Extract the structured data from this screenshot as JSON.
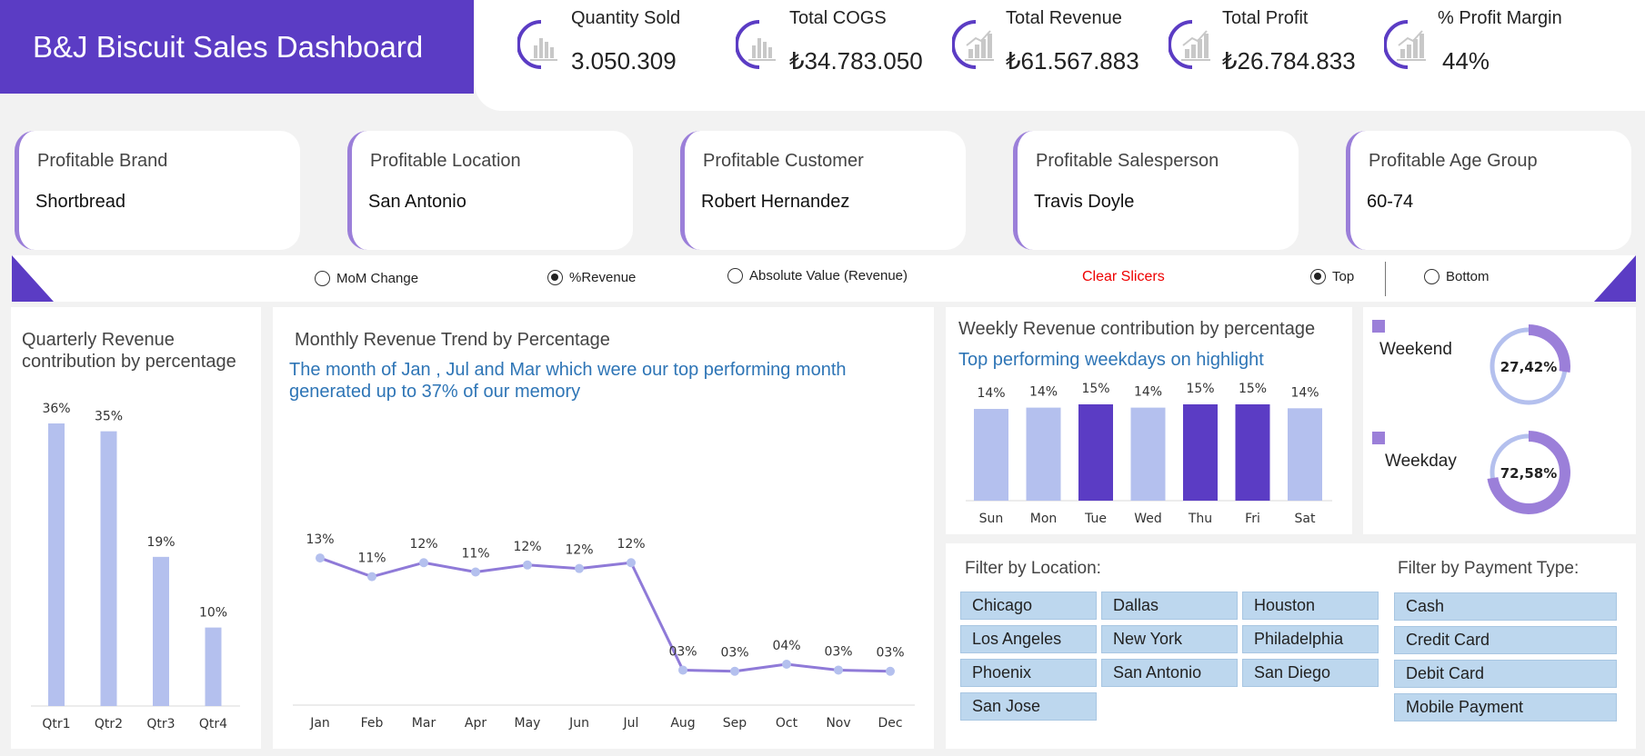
{
  "title": "B&J Biscuit Sales Dashboard",
  "kpis": [
    {
      "label": "Quantity Sold",
      "value": "3.050.309",
      "icon": "bar-chart-icon"
    },
    {
      "label": "Total COGS",
      "value": "₺34.783.050",
      "icon": "bar-chart-icon"
    },
    {
      "label": "Total Revenue",
      "value": "₺61.567.883",
      "icon": "growth-chart-icon"
    },
    {
      "label": "Total Profit",
      "value": "₺26.784.833",
      "icon": "growth-chart-icon"
    },
    {
      "label": "% Profit Margin",
      "value": "44%",
      "icon": "growth-chart-icon"
    }
  ],
  "profitable": [
    {
      "label": "Profitable Brand",
      "value": "Shortbread"
    },
    {
      "label": "Profitable Location",
      "value": "San Antonio"
    },
    {
      "label": "Profitable Customer",
      "value": "Robert Hernandez"
    },
    {
      "label": "Profitable Salesperson",
      "value": "Travis Doyle"
    },
    {
      "label": "Profitable Age Group",
      "value": "60-74"
    }
  ],
  "slicers": {
    "mom": "MoM Change",
    "pct": "%Revenue",
    "abs": "Absolute Value (Revenue)",
    "clear": "Clear Slicers",
    "top": "Top",
    "bottom": "Bottom",
    "selected_metric": "%Revenue",
    "selected_rank": "Top"
  },
  "quarterly": {
    "title_line1": "Quarterly Revenue",
    "title_line2": "contribution by percentage"
  },
  "monthly": {
    "title": "Monthly Revenue Trend by Percentage",
    "subtitle_line1": "The month of Jan , Jul and Mar which were our top performing month",
    "subtitle_line2": "generated up to 37% of our memory"
  },
  "weekly": {
    "title": "Weekly Revenue contribution by percentage",
    "subtitle": "Top performing weekdays on highlight"
  },
  "split": {
    "weekend_label": "Weekend",
    "weekend_value": "27,42%",
    "weekday_label": "Weekday",
    "weekday_value": "72,58%"
  },
  "filters": {
    "location_title": "Filter by Location:",
    "locations": [
      "Chicago",
      "Dallas",
      "Houston",
      "Los Angeles",
      "New York",
      "Philadelphia",
      "Phoenix",
      "San Antonio",
      "San Diego",
      "San Jose"
    ],
    "payment_title": "Filter by Payment Type:",
    "payments": [
      "Cash",
      "Credit Card",
      "Debit Card",
      "Mobile Payment"
    ]
  },
  "colors": {
    "accent": "#5b3cc4",
    "bar_light": "#b4c0ee",
    "bar_highlight": "#5b3cc4",
    "line": "#8f7ad8",
    "filter_button": "#bdd7ee",
    "clear": "#e00000"
  },
  "chart_data": [
    {
      "type": "bar",
      "categories": [
        "Qtr1",
        "Qtr2",
        "Qtr3",
        "Qtr4"
      ],
      "values": [
        36,
        35,
        19,
        10
      ],
      "labels": [
        "36%",
        "35%",
        "19%",
        "10%"
      ],
      "ylim": [
        0,
        36
      ],
      "grid": false
    },
    {
      "type": "line",
      "categories": [
        "Jan",
        "Feb",
        "Mar",
        "Apr",
        "May",
        "Jun",
        "Jul",
        "Aug",
        "Sep",
        "Oct",
        "Nov",
        "Dec"
      ],
      "values": [
        12.6,
        11.0,
        12.2,
        11.4,
        12.0,
        11.7,
        12.2,
        3.0,
        2.9,
        3.5,
        3.0,
        2.9
      ],
      "labels": [
        "13%",
        "11%",
        "12%",
        "11%",
        "12%",
        "12%",
        "12%",
        "03%",
        "03%",
        "04%",
        "03%",
        "03%"
      ],
      "ylim": [
        0,
        20
      ],
      "grid": false
    },
    {
      "type": "bar",
      "categories": [
        "Sun",
        "Mon",
        "Tue",
        "Wed",
        "Thu",
        "Fri",
        "Sat"
      ],
      "values": [
        14.0,
        14.2,
        14.7,
        14.2,
        14.7,
        14.7,
        14.1
      ],
      "labels": [
        "14%",
        "14%",
        "15%",
        "14%",
        "15%",
        "15%",
        "14%"
      ],
      "highlight": [
        false,
        false,
        true,
        false,
        true,
        true,
        false
      ],
      "ylim": [
        0,
        14.7
      ],
      "grid": false
    },
    {
      "type": "pie",
      "categories": [
        "Weekend",
        "Weekday"
      ],
      "values": [
        27.42,
        72.58
      ]
    }
  ]
}
